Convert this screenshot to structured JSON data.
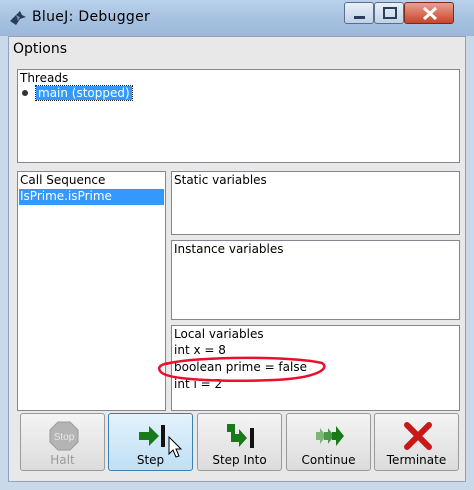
{
  "window": {
    "title": "BlueJ:  Debugger",
    "icons": {
      "app": "bluej-bird-icon",
      "minimize": "minimize-icon",
      "maximize": "maximize-icon",
      "close": "close-icon"
    }
  },
  "menu": {
    "options": "Options"
  },
  "threads": {
    "header": "Threads",
    "items": [
      {
        "label": "main (stopped)",
        "selected": true
      }
    ]
  },
  "call_sequence": {
    "header": "Call Sequence",
    "items": [
      {
        "label": "IsPrime.isPrime",
        "selected": true
      }
    ]
  },
  "static_vars": {
    "header": "Static variables"
  },
  "instance_vars": {
    "header": "Instance variables"
  },
  "local_vars": {
    "header": "Local variables",
    "items": [
      "int x = 8",
      "boolean prime = false",
      "int i = 2"
    ],
    "highlight_color": "#e8102a"
  },
  "buttons": {
    "halt": {
      "label": "Halt",
      "icon_text": "Stop",
      "enabled": false
    },
    "step": {
      "label": "Step",
      "active": true
    },
    "step_into": {
      "label": "Step Into"
    },
    "continue": {
      "label": "Continue"
    },
    "terminate": {
      "label": "Terminate"
    }
  },
  "colors": {
    "selection": "#3399ff",
    "step_arrow": "#1a7a1a",
    "terminate_x": "#c81818"
  }
}
